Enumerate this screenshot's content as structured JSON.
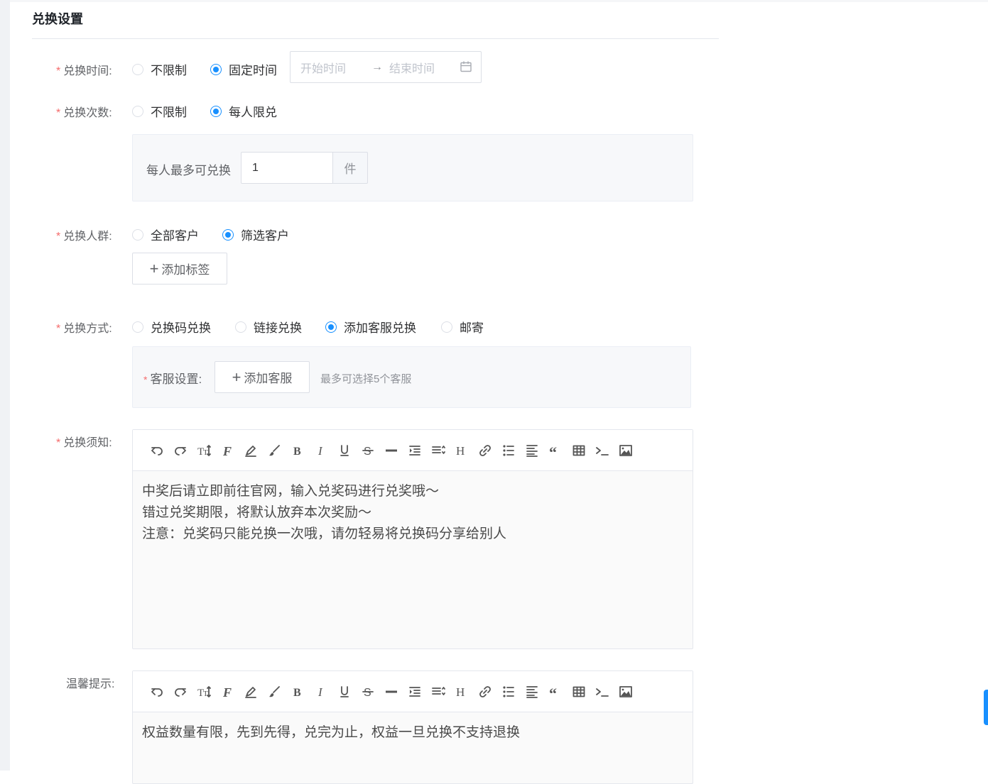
{
  "section": {
    "title": "兑换设置"
  },
  "exchange_time": {
    "label": "兑换时间:",
    "options": [
      "不限制",
      "固定时间"
    ],
    "selected": "固定时间",
    "range": {
      "start_placeholder": "开始时间",
      "separator": "→",
      "end_placeholder": "结束时间"
    }
  },
  "exchange_count": {
    "label": "兑换次数:",
    "options": [
      "不限制",
      "每人限兑"
    ],
    "selected": "每人限兑",
    "per_person": {
      "label": "每人最多可兑换",
      "value": "1",
      "unit": "件"
    }
  },
  "exchange_crowd": {
    "label": "兑换人群:",
    "options": [
      "全部客户",
      "筛选客户"
    ],
    "selected": "筛选客户",
    "add_tag_label": "添加标签"
  },
  "exchange_method": {
    "label": "兑换方式:",
    "options": [
      "兑换码兑换",
      "链接兑换",
      "添加客服兑换",
      "邮寄"
    ],
    "selected": "添加客服兑换",
    "service": {
      "label": "客服设置:",
      "add_label": "添加客服",
      "hint": "最多可选择5个客服"
    }
  },
  "exchange_notice": {
    "label": "兑换须知:",
    "lines": [
      "中奖后请立即前往官网，输入兑奖码进行兑奖哦～",
      "错过兑奖期限，将默认放弃本次奖励～",
      "注意：兑奖码只能兑换一次哦，请勿轻易将兑换码分享给别人"
    ]
  },
  "warm_tips": {
    "label": "温馨提示:",
    "lines": [
      "权益数量有限，先到先得，兑完为止，权益一旦兑换不支持退换"
    ]
  },
  "toolbar": [
    "undo-icon",
    "redo-icon",
    "font-size-icon",
    "font-family-icon",
    "highlight-icon",
    "paint-brush-icon",
    "bold-icon",
    "italic-icon",
    "underline-icon",
    "strikethrough-icon",
    "horizontal-rule-icon",
    "indent-icon",
    "line-height-icon",
    "heading-icon",
    "link-icon",
    "bullet-list-icon",
    "align-icon",
    "quote-icon",
    "table-icon",
    "code-icon",
    "image-icon"
  ],
  "colors": {
    "primary": "#1890ff",
    "required": "#f56c6c",
    "border": "#dcdfe6"
  }
}
